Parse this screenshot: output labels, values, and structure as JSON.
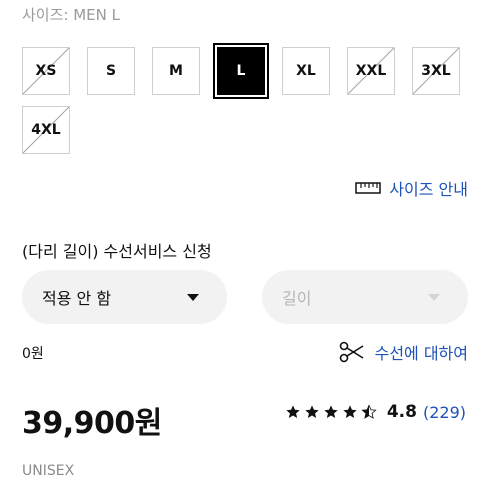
{
  "size_label": "사이즈: MEN L",
  "sizes": [
    {
      "label": "XS",
      "state": "unavailable"
    },
    {
      "label": "S",
      "state": "available"
    },
    {
      "label": "M",
      "state": "available"
    },
    {
      "label": "L",
      "state": "selected"
    },
    {
      "label": "XL",
      "state": "available"
    },
    {
      "label": "XXL",
      "state": "unavailable"
    },
    {
      "label": "3XL",
      "state": "unavailable"
    },
    {
      "label": "4XL",
      "state": "unavailable"
    }
  ],
  "size_guide": {
    "label": "사이즈 안내",
    "icon": "ruler-icon"
  },
  "repair": {
    "title": "(다리 길이) 수선서비스 신청",
    "apply_select": {
      "value": "적용 안 함"
    },
    "length_select": {
      "placeholder": "길이"
    },
    "price": "0원",
    "link_label": "수선에 대하여",
    "link_icon": "scissors-icon"
  },
  "product": {
    "price": "39,900원",
    "rating": "4.8",
    "rating_value": 4.8,
    "review_count": "(229)",
    "gender": "UNISEX"
  },
  "colors": {
    "accent": "#1d52b8",
    "selected_bg": "#000000",
    "select_bg": "#f2f2f2"
  }
}
